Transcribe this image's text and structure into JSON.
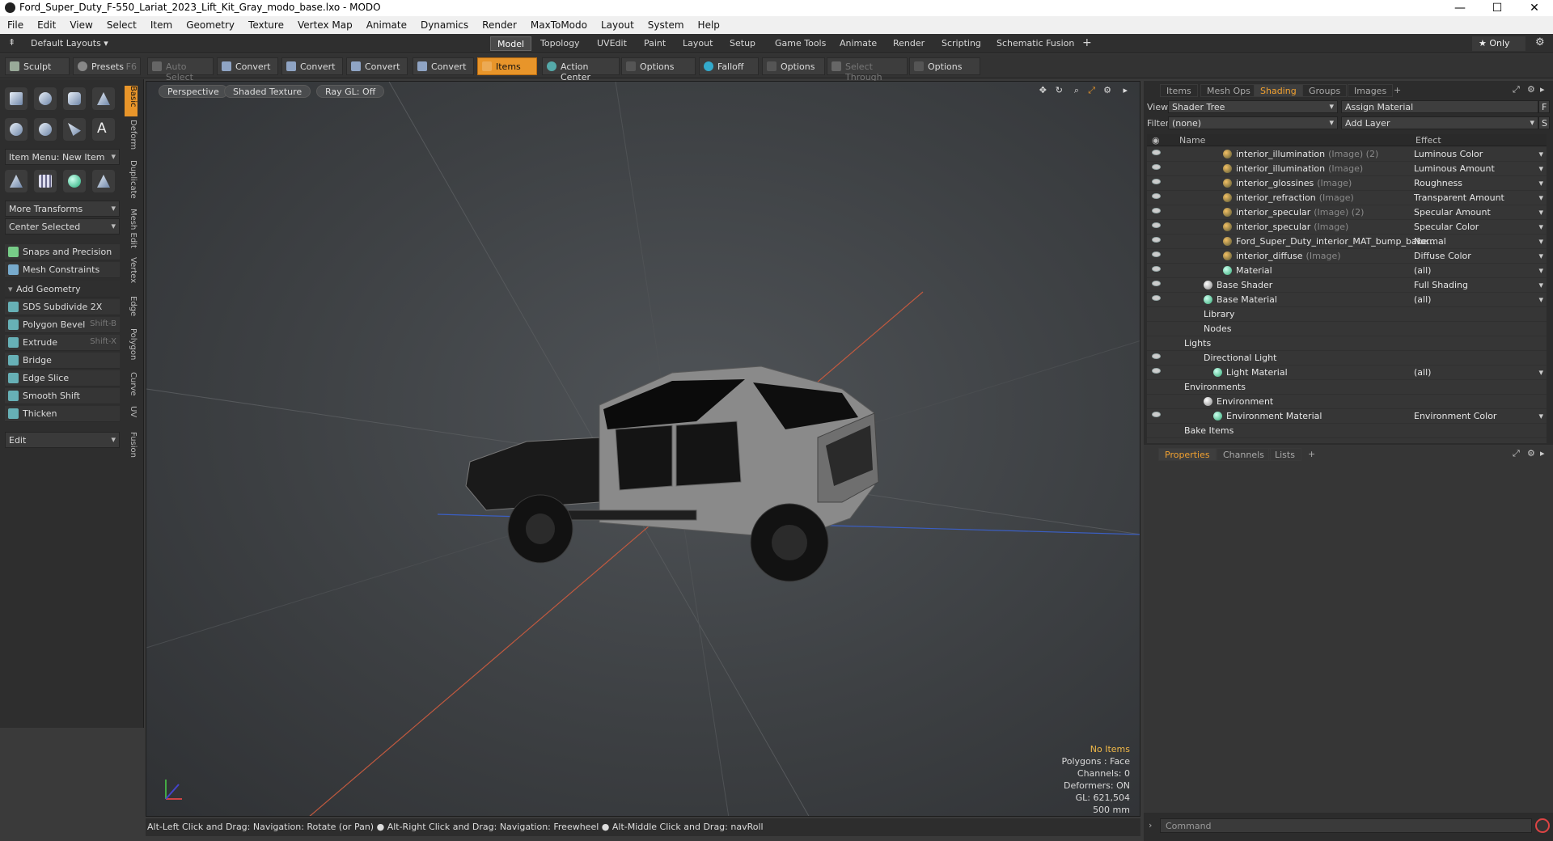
{
  "window": {
    "title": "Ford_Super_Duty_F-550_Lariat_2023_Lift_Kit_Gray_modo_base.lxo - MODO",
    "minimize": "—",
    "maximize": "☐",
    "close": "✕"
  },
  "menu": [
    "File",
    "Edit",
    "View",
    "Select",
    "Item",
    "Geometry",
    "Texture",
    "Vertex Map",
    "Animate",
    "Dynamics",
    "Render",
    "MaxToModo",
    "Layout",
    "System",
    "Help"
  ],
  "layoutbar": {
    "layouts_label": "Default Layouts ▾",
    "tabs": [
      "Model",
      "Topology",
      "UVEdit",
      "Paint",
      "Layout",
      "Setup",
      "Game Tools",
      "Animate",
      "Render",
      "Scripting",
      "Schematic Fusion"
    ],
    "active_tab": "Model",
    "add": "+",
    "only": "★  Only",
    "gear": "⚙"
  },
  "toolbar": {
    "sculpt": "Sculpt",
    "presets": "Presets",
    "presets_key": "F6",
    "auto_select": "Auto Select",
    "convert1": "Convert",
    "convert2": "Convert",
    "convert3": "Convert",
    "convert4": "Convert",
    "items": "Items",
    "action_center": "Action Center",
    "options1": "Options",
    "falloff": "Falloff",
    "options2": "Options",
    "select_through": "Select Through",
    "options3": "Options"
  },
  "left": {
    "item_menu": "Item Menu: New Item",
    "more_transforms": "More Transforms",
    "center_selected": "Center Selected",
    "snaps": "Snaps and Precision",
    "mesh_constraints": "Mesh Constraints",
    "add_geometry": "Add Geometry",
    "tools": [
      {
        "label": "SDS Subdivide 2X",
        "key": ""
      },
      {
        "label": "Polygon Bevel",
        "key": "Shift-B"
      },
      {
        "label": "Extrude",
        "key": "Shift-X"
      },
      {
        "label": "Bridge",
        "key": ""
      },
      {
        "label": "Edge Slice",
        "key": ""
      },
      {
        "label": "Smooth Shift",
        "key": ""
      },
      {
        "label": "Thicken",
        "key": ""
      }
    ],
    "edit": "Edit",
    "vtabs": [
      "Basic",
      "Deform",
      "Duplicate",
      "Mesh Edit",
      "Vertex",
      "Edge",
      "Polygon",
      "Curve",
      "UV",
      "Fusion"
    ]
  },
  "viewport": {
    "perspective": "Perspective",
    "shaded": "Shaded Texture",
    "raygl": "Ray GL: Off",
    "info": {
      "no_items": "No Items",
      "polygons": "Polygons : Face",
      "channels": "Channels: 0",
      "deformers": "Deformers: ON",
      "gl": "GL: 621,504",
      "scale": "500 mm"
    }
  },
  "status": "Alt-Left Click and Drag: Navigation: Rotate (or Pan) ● Alt-Right Click and Drag: Navigation: Freewheel ● Alt-Middle Click and Drag: navRoll",
  "right": {
    "tabs": [
      "Items",
      "Mesh Ops",
      "Shading",
      "Groups",
      "Images",
      "+"
    ],
    "active_tab": "Shading",
    "view_label": "View",
    "view_value": "Shader Tree",
    "assign_material": "Assign Material",
    "f_btn": "F",
    "filter_label": "Filter",
    "filter_value": "(none)",
    "add_layer": "Add Layer",
    "s_btn": "S",
    "col_name": "Name",
    "col_effect": "Effect",
    "rows": [
      {
        "name": "interior_illumination",
        "tag": "(Image) (2)",
        "effect": "Luminous Color",
        "indent": 64,
        "kind": "img",
        "eye": true
      },
      {
        "name": "interior_illumination",
        "tag": "(Image)",
        "effect": "Luminous Amount",
        "indent": 64,
        "kind": "img",
        "eye": true
      },
      {
        "name": "interior_glossines",
        "tag": "(Image)",
        "effect": "Roughness",
        "indent": 64,
        "kind": "img",
        "eye": true
      },
      {
        "name": "interior_refraction",
        "tag": "(Image)",
        "effect": "Transparent Amount",
        "indent": 64,
        "kind": "img",
        "eye": true
      },
      {
        "name": "interior_specular",
        "tag": "(Image) (2)",
        "effect": "Specular Amount",
        "indent": 64,
        "kind": "img",
        "eye": true
      },
      {
        "name": "interior_specular",
        "tag": "(Image)",
        "effect": "Specular Color",
        "indent": 64,
        "kind": "img",
        "eye": true
      },
      {
        "name": "Ford_Super_Duty_interior_MAT_bump_bake...",
        "tag": "",
        "effect": "Normal",
        "indent": 64,
        "kind": "img",
        "eye": true
      },
      {
        "name": "interior_diffuse",
        "tag": "(Image)",
        "effect": "Diffuse Color",
        "indent": 64,
        "kind": "img",
        "eye": true
      },
      {
        "name": "Material",
        "tag": "",
        "effect": "(all)",
        "indent": 64,
        "kind": "mat",
        "eye": true
      },
      {
        "name": "Base Shader",
        "tag": "",
        "effect": "Full Shading",
        "indent": 40,
        "kind": "shader",
        "eye": true
      },
      {
        "name": "Base Material",
        "tag": "",
        "effect": "(all)",
        "indent": 40,
        "kind": "mat",
        "eye": true
      },
      {
        "name": "Library",
        "tag": "",
        "effect": "",
        "indent": 40,
        "kind": "none",
        "eye": false
      },
      {
        "name": "Nodes",
        "tag": "",
        "effect": "",
        "indent": 40,
        "kind": "none",
        "eye": false
      },
      {
        "name": "Lights",
        "tag": "",
        "effect": "",
        "indent": 16,
        "kind": "none",
        "eye": false
      },
      {
        "name": "Directional Light",
        "tag": "",
        "effect": "",
        "indent": 40,
        "kind": "none",
        "eye": true
      },
      {
        "name": "Light Material",
        "tag": "",
        "effect": "(all)",
        "indent": 52,
        "kind": "mat",
        "eye": true
      },
      {
        "name": "Environments",
        "tag": "",
        "effect": "",
        "indent": 16,
        "kind": "none",
        "eye": false
      },
      {
        "name": "Environment",
        "tag": "",
        "effect": "",
        "indent": 40,
        "kind": "shader",
        "eye": false
      },
      {
        "name": "Environment Material",
        "tag": "",
        "effect": "Environment Color",
        "indent": 52,
        "kind": "mat",
        "eye": true
      },
      {
        "name": "Bake Items",
        "tag": "",
        "effect": "",
        "indent": 16,
        "kind": "none",
        "eye": false
      }
    ],
    "prop_tabs": [
      "Properties",
      "Channels",
      "Lists",
      "+"
    ],
    "command_placeholder": "Command"
  },
  "colors": {
    "accent": "#e8952a",
    "panel": "#2c2c2c",
    "viewport_bg": "#45484b"
  }
}
